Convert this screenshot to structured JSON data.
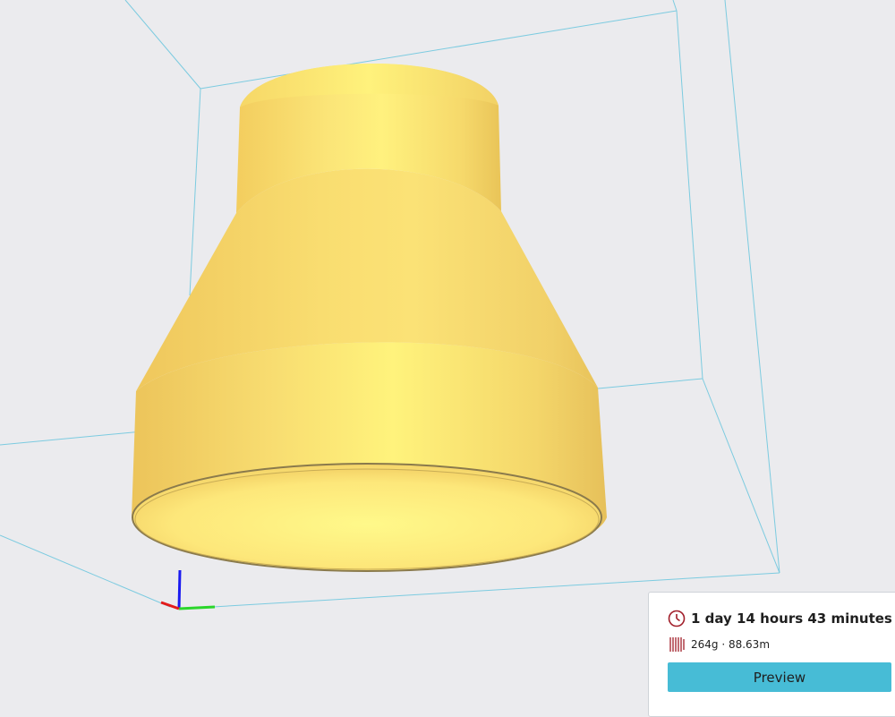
{
  "print_info": {
    "time": "1 day 14 hours 43 minutes",
    "material": "264g · 88.63m",
    "clock_icon": "clock-icon",
    "filament_icon": "filament-icon"
  },
  "actions": {
    "preview_label": "Preview"
  },
  "colors": {
    "background": "#ebebee",
    "build_volume": "#7ccbe0",
    "model": "#fbe27a",
    "accent": "#47bcd6",
    "icon_red": "#a11e2a",
    "axis_x": "#e31b1b",
    "axis_y": "#2bd62b",
    "axis_z": "#1b1bf0"
  }
}
